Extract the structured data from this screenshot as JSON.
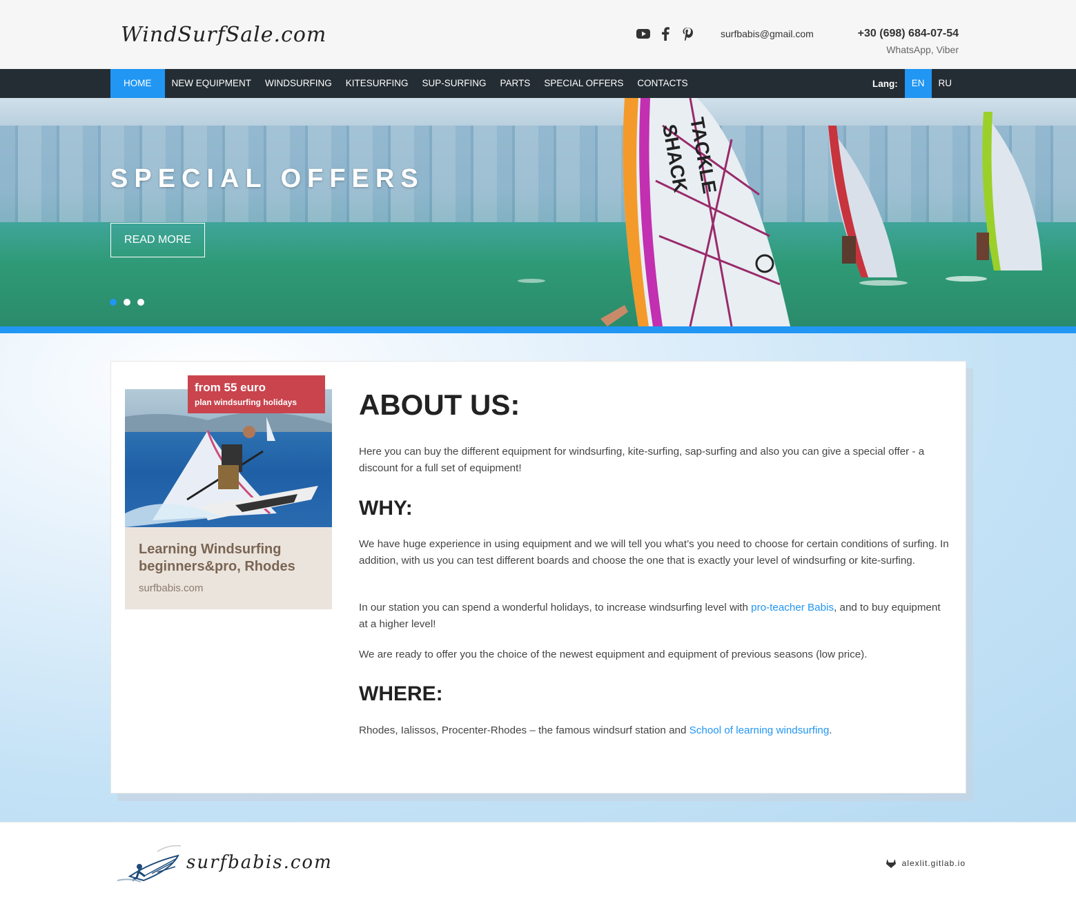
{
  "header": {
    "logo_text": "WindSurfSale.com",
    "social": [
      "youtube-icon",
      "facebook-icon",
      "pinterest-icon"
    ],
    "email": "surfbabis@gmail.com",
    "phone": "+30 (698) 684-07-54",
    "phone_note": "WhatsApp, Viber"
  },
  "nav": {
    "items": [
      "HOME",
      "NEW EQUIPMENT",
      "WINDSURFING",
      "KITESURFING",
      "SUP-SURFING",
      "PARTS",
      "SPECIAL OFFERS",
      "CONTACTS"
    ],
    "active": "HOME",
    "lang_label": "Lang:",
    "languages": [
      "EN",
      "RU"
    ],
    "active_lang": "EN"
  },
  "hero": {
    "title": "SPECIAL OFFERS",
    "button": "READ MORE",
    "slides": 3,
    "active_slide": 1
  },
  "promo": {
    "badge_price": "from 55 euro",
    "badge_subtitle": "plan windsurfing holidays",
    "title": "Learning Windsurfing beginners&pro, Rhodes",
    "url": "surfbabis.com"
  },
  "about": {
    "heading": "ABOUT US:",
    "p1": "Here you can buy the different equipment for windsurfing, kite-surfing, sap-surfing and also you can give a special offer - a discount for a full set of equipment!",
    "why_heading": "WHY:",
    "p2": "We have huge experience in using equipment and we will tell you what’s you need to choose for certain conditions of surfing. In addition, with us you can test different boards and choose the one that is exactly your level of windsurfing or kite-surfing.",
    "p3_before": "In our station you can spend a wonderful holidays, to increase windsurfing level with ",
    "p3_link": "pro-teacher Babis",
    "p3_after": ", and to buy equipment at a higher level!",
    "p4": "We are ready to offer you the choice of the newest equipment and equipment of previous seasons (low price).",
    "where_heading": "WHERE:",
    "p5_before": "Rhodes, Ialissos, Procenter-Rhodes – the famous windsurf station and ",
    "p5_link": "School of learning windsurfing",
    "p5_after": "."
  },
  "footer": {
    "logo_text": "surfbabis.com",
    "credit": "alexlit.gitlab.io"
  },
  "colors": {
    "accent": "#2196f3",
    "nav_bg": "#242d33",
    "badge": "#c9444d",
    "promo_bg": "#ebe4dd"
  }
}
